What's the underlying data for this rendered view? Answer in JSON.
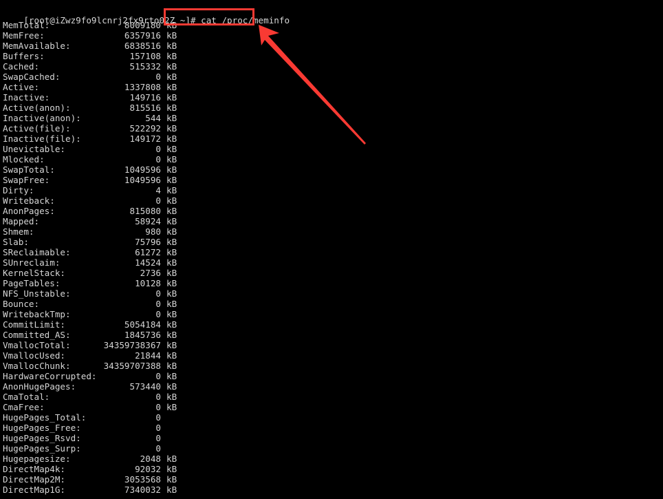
{
  "terminal": {
    "background_color": "#000000",
    "foreground_color": "#d6d6d6",
    "prompt": "[root@iZwz9fo9lcnrj2fx9rto02Z ~]# ",
    "command": "cat /proc/meminfo",
    "full_prompt_line": "[root@iZwz9fo9lcnrj2fx9rto02Z ~]# cat /proc/meminfo",
    "user": "root",
    "hostname": "iZwz9fo9lcnrj2fx9rto02Z",
    "working_directory": "~",
    "prompt_symbol": "#"
  },
  "annotations": {
    "highlight_color": "#f93a33",
    "command_box_label": "command-highlight-box",
    "arrow_label": "annotation-arrow",
    "arrow_points_to": "cat /proc/meminfo"
  },
  "meminfo": {
    "rows": [
      {
        "label": "MemTotal:",
        "value": "8009180",
        "unit": "kB"
      },
      {
        "label": "MemFree:",
        "value": "6357916",
        "unit": "kB"
      },
      {
        "label": "MemAvailable:",
        "value": "6838516",
        "unit": "kB"
      },
      {
        "label": "Buffers:",
        "value": "157108",
        "unit": "kB"
      },
      {
        "label": "Cached:",
        "value": "515332",
        "unit": "kB"
      },
      {
        "label": "SwapCached:",
        "value": "0",
        "unit": "kB"
      },
      {
        "label": "Active:",
        "value": "1337808",
        "unit": "kB"
      },
      {
        "label": "Inactive:",
        "value": "149716",
        "unit": "kB"
      },
      {
        "label": "Active(anon):",
        "value": "815516",
        "unit": "kB"
      },
      {
        "label": "Inactive(anon):",
        "value": "544",
        "unit": "kB"
      },
      {
        "label": "Active(file):",
        "value": "522292",
        "unit": "kB"
      },
      {
        "label": "Inactive(file):",
        "value": "149172",
        "unit": "kB"
      },
      {
        "label": "Unevictable:",
        "value": "0",
        "unit": "kB"
      },
      {
        "label": "Mlocked:",
        "value": "0",
        "unit": "kB"
      },
      {
        "label": "SwapTotal:",
        "value": "1049596",
        "unit": "kB"
      },
      {
        "label": "SwapFree:",
        "value": "1049596",
        "unit": "kB"
      },
      {
        "label": "Dirty:",
        "value": "4",
        "unit": "kB"
      },
      {
        "label": "Writeback:",
        "value": "0",
        "unit": "kB"
      },
      {
        "label": "AnonPages:",
        "value": "815080",
        "unit": "kB"
      },
      {
        "label": "Mapped:",
        "value": "58924",
        "unit": "kB"
      },
      {
        "label": "Shmem:",
        "value": "980",
        "unit": "kB"
      },
      {
        "label": "Slab:",
        "value": "75796",
        "unit": "kB"
      },
      {
        "label": "SReclaimable:",
        "value": "61272",
        "unit": "kB"
      },
      {
        "label": "SUnreclaim:",
        "value": "14524",
        "unit": "kB"
      },
      {
        "label": "KernelStack:",
        "value": "2736",
        "unit": "kB"
      },
      {
        "label": "PageTables:",
        "value": "10128",
        "unit": "kB"
      },
      {
        "label": "NFS_Unstable:",
        "value": "0",
        "unit": "kB"
      },
      {
        "label": "Bounce:",
        "value": "0",
        "unit": "kB"
      },
      {
        "label": "WritebackTmp:",
        "value": "0",
        "unit": "kB"
      },
      {
        "label": "CommitLimit:",
        "value": "5054184",
        "unit": "kB"
      },
      {
        "label": "Committed_AS:",
        "value": "1845736",
        "unit": "kB"
      },
      {
        "label": "VmallocTotal:",
        "value": "34359738367",
        "unit": "kB"
      },
      {
        "label": "VmallocUsed:",
        "value": "21844",
        "unit": "kB"
      },
      {
        "label": "VmallocChunk:",
        "value": "34359707388",
        "unit": "kB"
      },
      {
        "label": "HardwareCorrupted:",
        "value": "0",
        "unit": "kB"
      },
      {
        "label": "AnonHugePages:",
        "value": "573440",
        "unit": "kB"
      },
      {
        "label": "CmaTotal:",
        "value": "0",
        "unit": "kB"
      },
      {
        "label": "CmaFree:",
        "value": "0",
        "unit": "kB"
      },
      {
        "label": "HugePages_Total:",
        "value": "0",
        "unit": ""
      },
      {
        "label": "HugePages_Free:",
        "value": "0",
        "unit": ""
      },
      {
        "label": "HugePages_Rsvd:",
        "value": "0",
        "unit": ""
      },
      {
        "label": "HugePages_Surp:",
        "value": "0",
        "unit": ""
      },
      {
        "label": "Hugepagesize:",
        "value": "2048",
        "unit": "kB"
      },
      {
        "label": "DirectMap4k:",
        "value": "92032",
        "unit": "kB"
      },
      {
        "label": "DirectMap2M:",
        "value": "3053568",
        "unit": "kB"
      },
      {
        "label": "DirectMap1G:",
        "value": "7340032",
        "unit": "kB"
      }
    ]
  }
}
